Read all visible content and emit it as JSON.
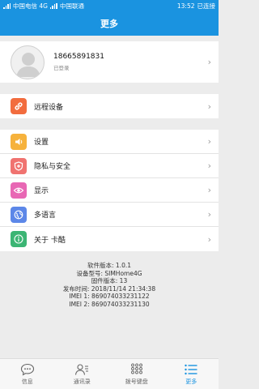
{
  "status_bar": {
    "carrier1": "中国电信 4G",
    "carrier2": "中国联通",
    "time": "13:52",
    "connection": "已连接"
  },
  "header": {
    "title": "更多"
  },
  "profile": {
    "phone": "18665891831",
    "status": "已登录"
  },
  "groups": [
    [
      {
        "label": "远程设备",
        "icon": "link-icon",
        "color": "#f26c3e"
      }
    ],
    [
      {
        "label": "设置",
        "icon": "speaker-icon",
        "color": "#f6b23c"
      },
      {
        "label": "隐私与安全",
        "icon": "shield-icon",
        "color": "#f07370"
      },
      {
        "label": "显示",
        "icon": "eye-icon",
        "color": "#e867b4"
      },
      {
        "label": "多语言",
        "icon": "globe-icon",
        "color": "#5c87e8"
      },
      {
        "label": "关于 卡酷",
        "icon": "info-icon",
        "color": "#3cb574"
      }
    ]
  ],
  "version": {
    "software": "软件版本: 1.0.1",
    "model": "设备型号: SIMHome4G",
    "firmware": "固件版本: 13",
    "release": "发布时间: 2018/11/14 21:34:38",
    "imei1": "IMEI 1: 869074033231122",
    "imei2": "IMEI 2: 869074033231130"
  },
  "tabs": [
    {
      "label": "信息",
      "icon": "chat-icon"
    },
    {
      "label": "通讯录",
      "icon": "contacts-icon"
    },
    {
      "label": "拨号键盘",
      "icon": "dialpad-icon"
    },
    {
      "label": "更多",
      "icon": "menu-icon",
      "active": true
    }
  ],
  "colors": {
    "accent": "#1a93e0",
    "background": "#ececec"
  }
}
